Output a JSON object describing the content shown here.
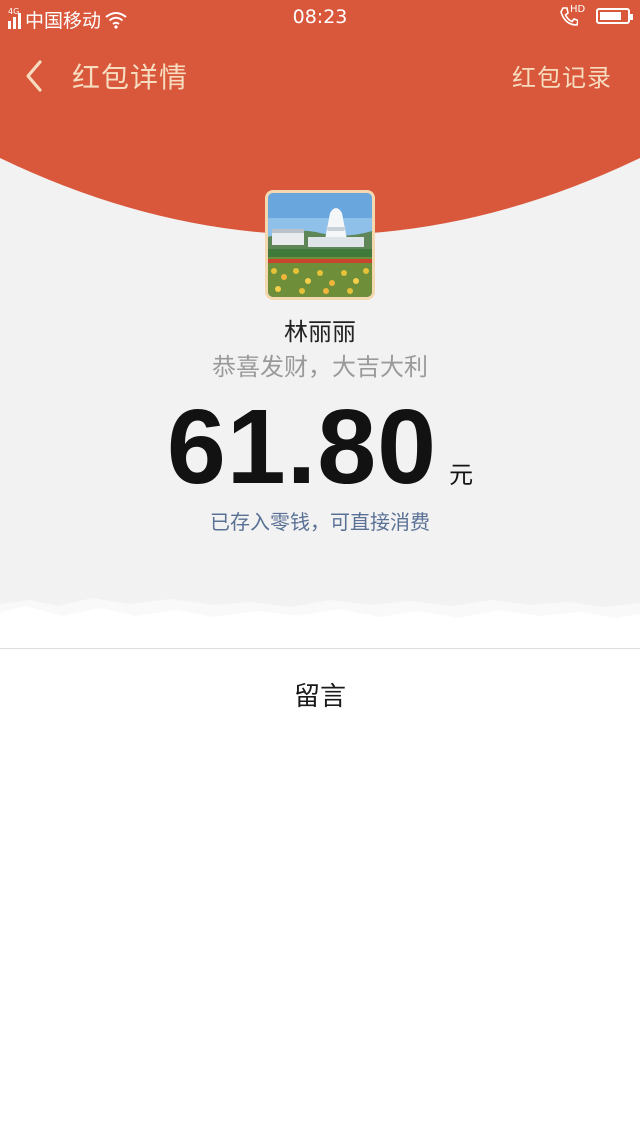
{
  "status_bar": {
    "network": "4G",
    "carrier": "中国移动",
    "time": "08:23",
    "call_badge": "HD",
    "battery_level": 0.8
  },
  "header": {
    "back_icon": "chevron-left-icon",
    "title": "红包详情",
    "records_label": "红包记录"
  },
  "sender": {
    "avatar_icon": "landscape-photo-avatar",
    "name": "林丽丽",
    "greeting": "恭喜发财，大吉大利"
  },
  "amount": {
    "value": "61.80",
    "unit": "元",
    "note": "已存入零钱，可直接消费"
  },
  "messages": {
    "label": "留言"
  },
  "colors": {
    "header_red": "#d9583c",
    "header_text": "#f7dcbf",
    "link_blue": "#5a7196"
  }
}
